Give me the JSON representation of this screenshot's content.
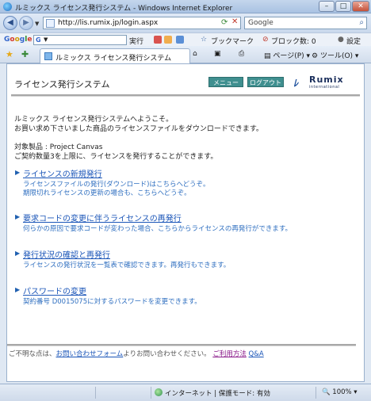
{
  "window": {
    "title": "ルミックス ライセンス発行システム - Windows Internet Explorer",
    "min_label": "–",
    "max_label": "□",
    "close_label": "✕"
  },
  "address": {
    "url": "http://lis.rumix.jp/login.aspx",
    "search_placeholder": "Google"
  },
  "google_bar": {
    "search_letter": "G",
    "execute_label": "実行",
    "bookmarks_label": "ブックマーク",
    "blocked_label": "ブロック数: 0",
    "settings_label": "設定"
  },
  "tab": {
    "label": "ルミックス ライセンス発行システム"
  },
  "toolbar": {
    "page_label": "ページ(P)",
    "tools_label": "ツール(O)"
  },
  "site": {
    "title": "ライセンス発行システム",
    "menu_button": "メニュー",
    "logout_button": "ログアウト",
    "logo_name": "Rumix",
    "logo_sub": "international",
    "welcome_line1": "ルミックス ライセンス発行システムへようこそ。",
    "welcome_line2": "お買い求め下さいました商品のライセンスファイルをダウンロードできます。",
    "product_line": "対象製品 : Project Canvas",
    "limit_line": "ご契約数量3を上限に、ライセンスを発行することができます。",
    "sections": [
      {
        "link": "ライセンスの新規発行",
        "desc": [
          "ライセンスファイルの発行(ダウンロード)はこちらへどうぞ。",
          "期限切れライセンスの更新の場合も、こちらへどうぞ。"
        ]
      },
      {
        "link": "要求コードの変更に伴うライセンスの再発行",
        "desc": [
          "何らかの原因で要求コードが変わった場合、こちらからライセンスの再発行ができます。"
        ]
      },
      {
        "link": "発行状況の確認と再発行",
        "desc": [
          "ライセンスの発行状況を一覧表で確認できます。再発行もできます。"
        ]
      },
      {
        "link": "パスワードの変更",
        "desc": [
          "契約番号 D0015075に対するパスワードを変更できます。"
        ]
      }
    ],
    "footer": {
      "prefix": "ご不明な点は、",
      "contact_link": "お問い合わせフォーム",
      "middle": "よりお問い合わせください。",
      "terms_link": "ご利用方法",
      "qa_link": "Q&A"
    }
  },
  "status": {
    "zone": "インターネット | 保護モード: 有効",
    "zoom": "100%"
  },
  "colors": {
    "link_blue": "#1a55b8",
    "header_button": "#3f8f8f",
    "logo_navy": "#1b2f5c"
  }
}
